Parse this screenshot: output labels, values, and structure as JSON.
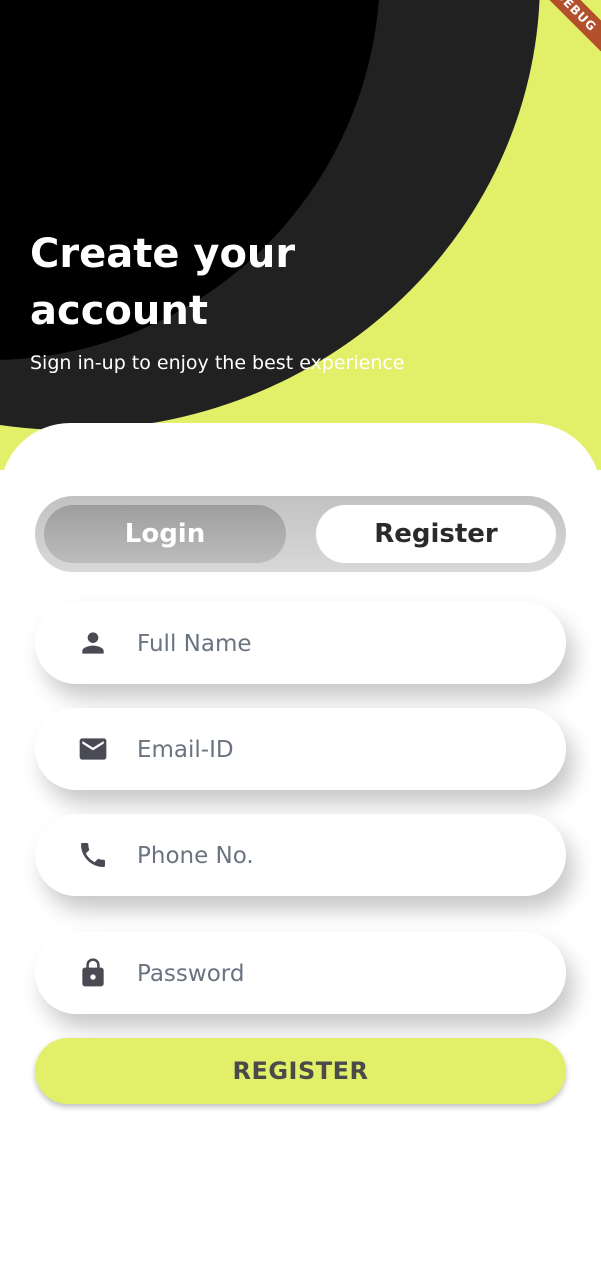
{
  "header": {
    "title": "Create your account",
    "subtitle": "Sign in-up to enjoy the best experience",
    "debug_banner": "DEBUG"
  },
  "tabs": {
    "login_label": "Login",
    "register_label": "Register",
    "active": "Register"
  },
  "form": {
    "full_name": {
      "placeholder": "Full Name",
      "icon": "person-icon"
    },
    "email": {
      "placeholder": "Email-ID",
      "icon": "email-icon"
    },
    "phone": {
      "placeholder": "Phone No.",
      "icon": "phone-icon"
    },
    "password": {
      "placeholder": "Password",
      "icon": "lock-icon"
    }
  },
  "actions": {
    "register_label": "REGISTER"
  },
  "colors": {
    "accent": "#e2ef68",
    "dark": "#000000",
    "ring": "#222122",
    "icon": "#4a4a54",
    "placeholder": "#6a7480"
  }
}
